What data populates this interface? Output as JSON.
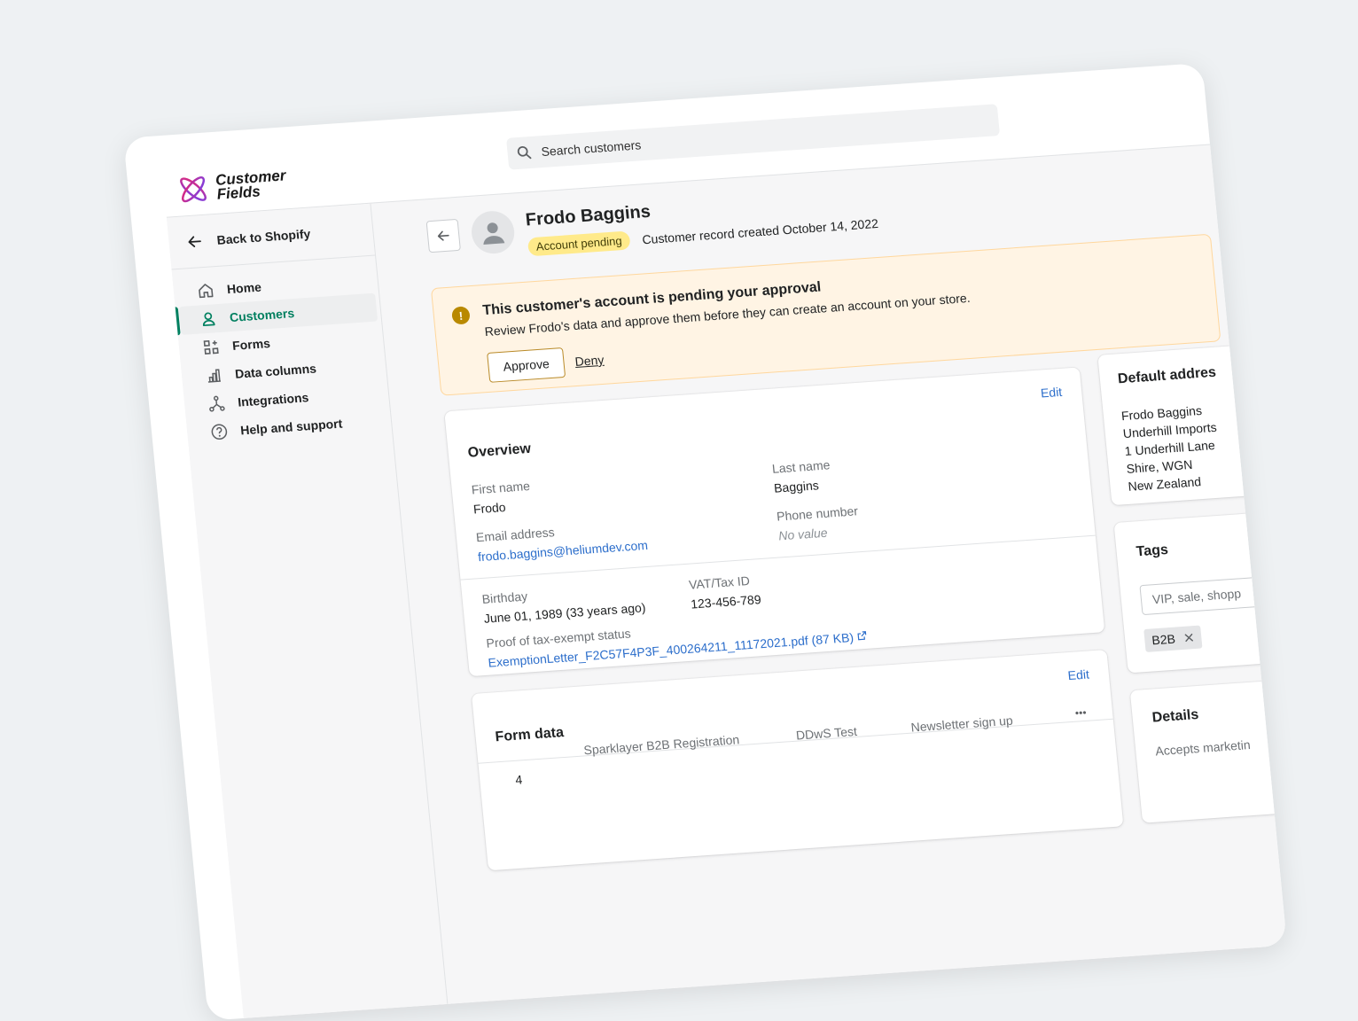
{
  "brand": {
    "name_line1": "Customer",
    "name_line2": "Fields"
  },
  "search": {
    "placeholder": "Search customers"
  },
  "sidebar": {
    "back_label": "Back to Shopify",
    "items": [
      {
        "label": "Home",
        "icon": "home-icon"
      },
      {
        "label": "Customers",
        "icon": "person-icon",
        "active": true
      },
      {
        "label": "Forms",
        "icon": "apps-icon"
      },
      {
        "label": "Data columns",
        "icon": "bar-chart-icon"
      },
      {
        "label": "Integrations",
        "icon": "integration-icon"
      },
      {
        "label": "Help and support",
        "icon": "question-circle-icon"
      }
    ]
  },
  "customer": {
    "name": "Frodo Baggins",
    "status_badge": "Account pending",
    "created_text": "Customer record created October 14, 2022"
  },
  "banner": {
    "title": "This customer's account is pending your approval",
    "text": "Review Frodo's data and approve them before they can create an account on your store.",
    "approve_label": "Approve",
    "deny_label": "Deny"
  },
  "overview": {
    "title": "Overview",
    "edit_label": "Edit",
    "first_name_label": "First name",
    "first_name": "Frodo",
    "last_name_label": "Last name",
    "last_name": "Baggins",
    "email_label": "Email address",
    "email": "frodo.baggins@heliumdev.com",
    "phone_label": "Phone number",
    "phone": "No value",
    "birthday_label": "Birthday",
    "birthday": "June 01, 1989 (33 years ago)",
    "vat_label": "VAT/Tax ID",
    "vat": "123-456-789",
    "proof_label": "Proof of tax-exempt status",
    "proof_file": "ExemptionLetter_F2C57F4P3F_400264211_11172021.pdf (87 KB)"
  },
  "form_data": {
    "title": "Form data",
    "edit_label": "Edit",
    "count": "4",
    "columns": [
      "Sparklayer B2B Registration",
      "DDwS Test",
      "Newsletter sign up"
    ],
    "more_label": "•••"
  },
  "default_address": {
    "title": "Default addres",
    "lines": [
      "Frodo Baggins",
      "Underhill Imports",
      "1 Underhill Lane",
      "Shire, WGN",
      "New Zealand"
    ]
  },
  "tags": {
    "title": "Tags",
    "placeholder": "VIP, sale, shopp",
    "chips": [
      "B2B"
    ]
  },
  "details": {
    "title": "Details",
    "text": "Accepts marketin"
  },
  "colors": {
    "accent_green": "#008060",
    "link_blue": "#2c6ecb",
    "pending_yellow": "#ffea8a",
    "banner_bg": "#fff4e4",
    "warning": "#b98900"
  }
}
